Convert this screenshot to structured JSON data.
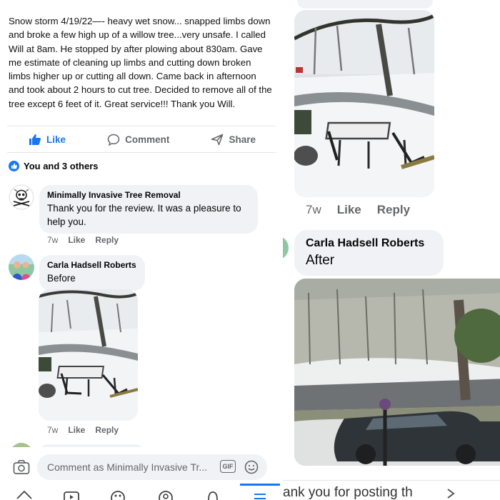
{
  "post": {
    "text": "Snow storm 4/19/22—- heavy wet snow... snapped limbs down and broke a few high up of a willow tree...very unsafe. I called Will at 8am. He stopped by after plowing about 830am. Gave me estimate of cleaning up limbs and cutting down broken limbs higher up or cutting all down. Came back in afternoon and took about 2 hours to cut tree. Decided to remove all of the tree except 6 feet of it. Great service!!! Thank you Will."
  },
  "actions": {
    "like": "Like",
    "comment": "Comment",
    "share": "Share"
  },
  "reactions": {
    "summary": "You and 3 others"
  },
  "comments": [
    {
      "author": "Minimally Invasive Tree Removal",
      "text": "Thank you for the review. It was a pleasure to help you.",
      "time": "7w",
      "like": "Like",
      "reply": "Reply"
    },
    {
      "author": "Carla Hadsell Roberts",
      "text": "Before",
      "time": "7w",
      "like": "Like",
      "reply": "Reply"
    }
  ],
  "composer": {
    "placeholder": "Comment as Minimally Invasive Tr...",
    "gif": "GIF"
  },
  "right": {
    "meta_top": {
      "time": "7w",
      "like": "Like",
      "reply": "Reply"
    },
    "comment": {
      "author": "Carla Hadsell Roberts",
      "text": "After"
    },
    "cut_text": "ank you for posting th"
  },
  "colors": {
    "accent": "#1877f2",
    "bubble": "#f0f2f5",
    "muted": "#65676b"
  }
}
